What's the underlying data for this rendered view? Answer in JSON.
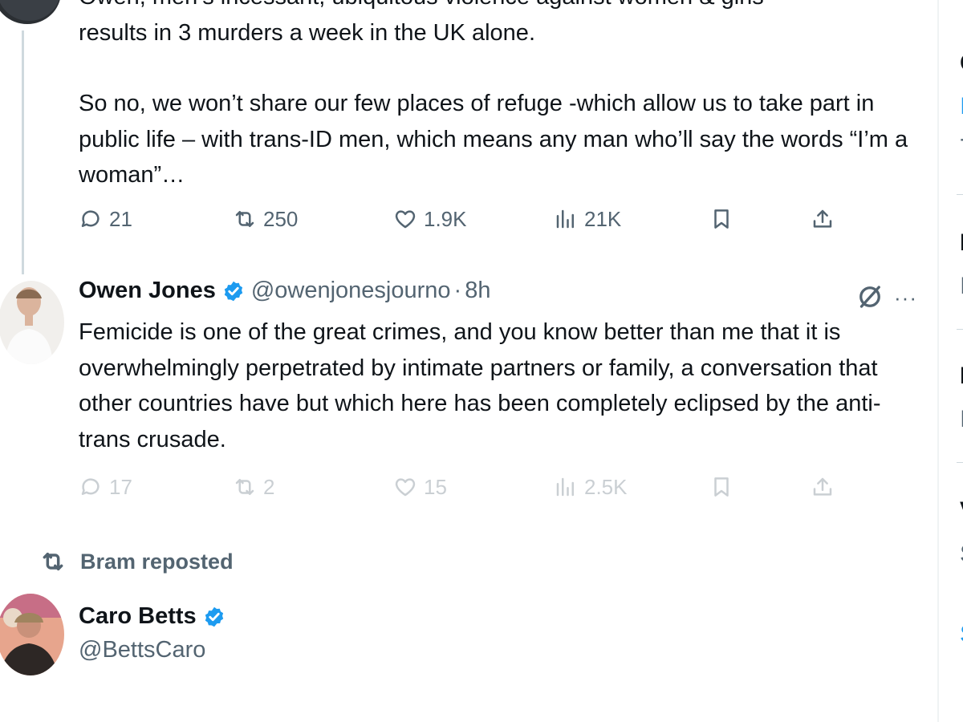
{
  "tweet1": {
    "paragraph1_partial": "Owen, men’s incessant, ubiquitous violence against women & girls",
    "paragraph1_line2": "results in 3 murders a week in the UK alone.",
    "paragraph2": "So no, we won’t share our few places of refuge -which allow us to take part in public life – with trans-ID men, which means any man who’ll say the words “I’m a woman”…",
    "replies": "21",
    "reposts": "250",
    "likes": "1.9K",
    "views": "21K"
  },
  "tweet2": {
    "name": "Owen Jones",
    "handle": "@owenjonesjourno",
    "separator": "·",
    "time": "8h",
    "text": "Femicide is one of the great crimes, and you know better than me that it is overwhelmingly perpetrated by intimate partners or family, a conversation that other countries have but which here has been completely eclipsed by the anti-trans crusade.",
    "replies": "17",
    "reposts": "2",
    "likes": "15",
    "views": "2.5K",
    "more": "···"
  },
  "repost": {
    "label": "Bram reposted"
  },
  "tweet3": {
    "name": "Caro Betts",
    "handle": "@BettsCaro"
  },
  "right_column": {
    "fragments": [
      "C",
      "I",
      "-",
      "I",
      "I",
      "I",
      "I",
      "V",
      "S",
      "S"
    ]
  },
  "colors": {
    "text": "#0f1419",
    "secondary": "#536471",
    "accent": "#1d9bf0",
    "border": "#cfd9de"
  }
}
